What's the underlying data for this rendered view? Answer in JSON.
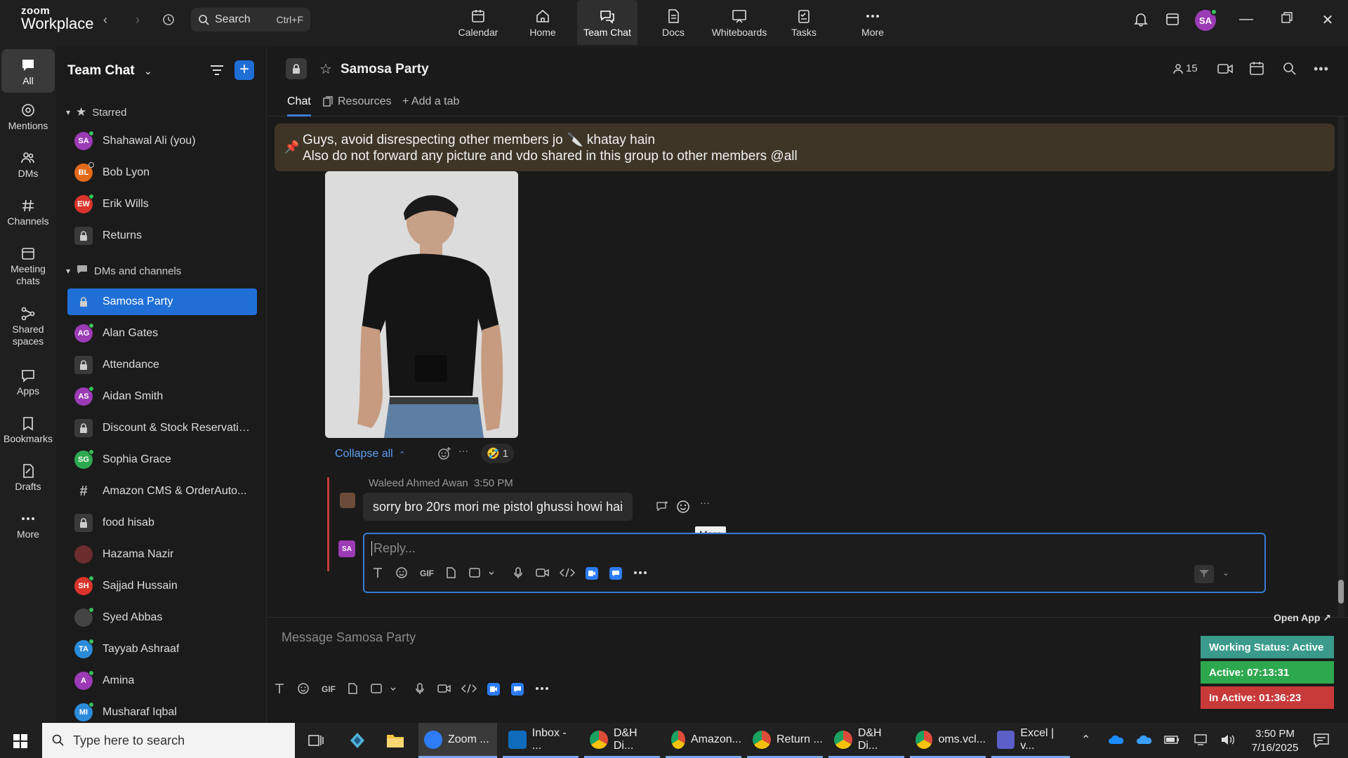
{
  "app": {
    "logo_top": "zoom",
    "logo_bottom": "Workplace"
  },
  "search": {
    "label": "Search",
    "shortcut": "Ctrl+F"
  },
  "topnav": [
    {
      "label": "Calendar"
    },
    {
      "label": "Home"
    },
    {
      "label": "Team Chat"
    },
    {
      "label": "Docs"
    },
    {
      "label": "Whiteboards"
    },
    {
      "label": "Tasks"
    },
    {
      "label": "More"
    }
  ],
  "user": {
    "initials": "SA"
  },
  "rail": [
    {
      "label": "All"
    },
    {
      "label": "Mentions"
    },
    {
      "label": "DMs"
    },
    {
      "label": "Channels"
    },
    {
      "label": "Meeting chats"
    },
    {
      "label": "Shared spaces"
    },
    {
      "label": "Apps"
    },
    {
      "label": "Bookmarks"
    },
    {
      "label": "Drafts"
    },
    {
      "label": "More"
    }
  ],
  "sidebar": {
    "title": "Team Chat",
    "starred_label": "Starred",
    "dms_label": "DMs and channels",
    "starred": [
      {
        "initials": "SA",
        "label": "Shahawal Ali (you)",
        "color": "#9b3bb5",
        "status": "#37c15a"
      },
      {
        "initials": "BL",
        "label": "Bob Lyon",
        "color": "#e26a1a",
        "status": "#1b1b1b"
      },
      {
        "initials": "EW",
        "label": "Erik Wills",
        "color": "#d9342b",
        "status": "#37c15a"
      },
      {
        "initials": "",
        "label": "Returns",
        "color": "#3a3a3a",
        "status": ""
      }
    ],
    "items": [
      {
        "initials": "",
        "label": "Samosa Party",
        "color": "#1f6fd6",
        "status": "",
        "active": true
      },
      {
        "initials": "AG",
        "label": "Alan Gates",
        "color": "#9b3bb5",
        "status": "#37c15a"
      },
      {
        "initials": "",
        "label": "Attendance",
        "color": "#3a3a3a",
        "status": ""
      },
      {
        "initials": "AS",
        "label": "Aidan Smith",
        "color": "#9b3bb5",
        "status": "#37c15a"
      },
      {
        "initials": "",
        "label": "Discount & Stock Reservatio...",
        "color": "#3a3a3a",
        "status": ""
      },
      {
        "initials": "SG",
        "label": "Sophia Grace",
        "color": "#2ea84f",
        "status": "#37c15a"
      },
      {
        "initials": "#",
        "label": "Amazon CMS & OrderAuto...",
        "color": "#1b1b1b",
        "status": ""
      },
      {
        "initials": "",
        "label": "food hisab",
        "color": "#3a3a3a",
        "status": ""
      },
      {
        "initials": "",
        "label": "Hazama Nazir",
        "color": "#6b2d2d",
        "status": ""
      },
      {
        "initials": "SH",
        "label": "Sajjad Hussain",
        "color": "#d9342b",
        "status": "#37c15a"
      },
      {
        "initials": "",
        "label": "Syed Abbas",
        "color": "#444",
        "status": "#37c15a"
      },
      {
        "initials": "TA",
        "label": "Tayyab Ashraaf",
        "color": "#2b8bd9",
        "status": "#37c15a"
      },
      {
        "initials": "A",
        "label": "Amina",
        "color": "#9b3bb5",
        "status": "#37c15a"
      },
      {
        "initials": "MI",
        "label": "Musharaf Iqbal",
        "color": "#2b8bd9",
        "status": "#37c15a"
      }
    ]
  },
  "channel": {
    "name": "Samosa Party",
    "member_count": "15",
    "tabs": [
      {
        "label": "Chat"
      },
      {
        "label": "Resources"
      },
      {
        "label": "Add a tab"
      }
    ]
  },
  "pinned": {
    "line1": "Guys, avoid disrespecting other members jo 🔪 khatay hain",
    "line2": "Also do not forward any picture and vdo shared in this group to other members @all"
  },
  "thread": {
    "collapse_label": "Collapse all",
    "reaction_emoji": "🤣",
    "reaction_count": "1",
    "reply_author": "Waleed Ahmed Awan",
    "reply_time": "3:50 PM",
    "reply_text": "sorry bro 20rs mori me pistol ghussi howi hai",
    "tooltip": "More",
    "reply_placeholder": "Reply..."
  },
  "compose": {
    "placeholder": "Message Samosa Party"
  },
  "status_widget": {
    "open_app": "Open App ↗",
    "working": "Working Status: Active",
    "active": "Active: 07:13:31",
    "inactive": "In Active: 01:36:23"
  },
  "taskbar": {
    "search_placeholder": "Type here to search",
    "apps": [
      {
        "label": "Zoom ..."
      },
      {
        "label": "Inbox - ..."
      },
      {
        "label": "D&H Di..."
      },
      {
        "label": "Amazon..."
      },
      {
        "label": "Return ..."
      },
      {
        "label": "D&H Di..."
      },
      {
        "label": "oms.vcl..."
      },
      {
        "label": "Excel | v..."
      }
    ],
    "time": "3:50 PM",
    "date": "7/16/2025"
  }
}
